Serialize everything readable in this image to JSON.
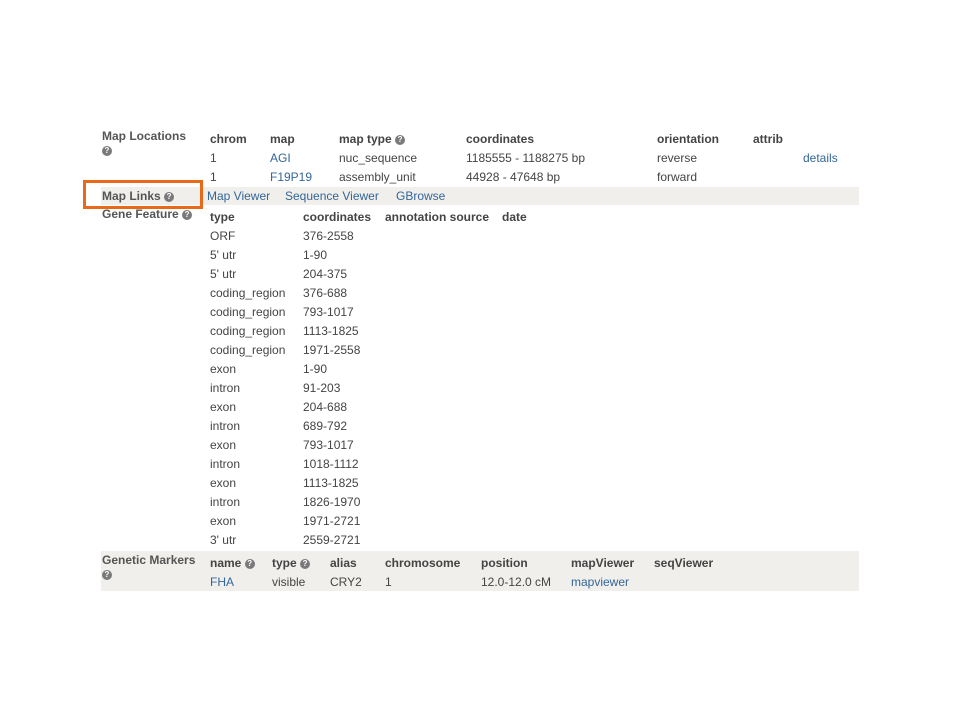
{
  "help_glyph": "?",
  "map_locations": {
    "title": "Map Locations",
    "headers": [
      "chrom",
      "map",
      "map type",
      "coordinates",
      "orientation",
      "attrib"
    ],
    "rows": [
      {
        "chrom": "1",
        "map": "AGI",
        "map_type": "nuc_sequence",
        "coordinates": "1185555 - 1188275 bp",
        "orientation": "reverse",
        "attrib": "details"
      },
      {
        "chrom": "1",
        "map": "F19P19",
        "map_type": "assembly_unit",
        "coordinates": "44928 - 47648 bp",
        "orientation": "forward",
        "attrib": ""
      }
    ]
  },
  "map_links": {
    "title": "Map Links",
    "links": [
      "Map Viewer",
      "Sequence Viewer",
      "GBrowse"
    ]
  },
  "gene_feature": {
    "title": "Gene Feature",
    "headers": [
      "type",
      "coordinates",
      "annotation source",
      "date"
    ],
    "rows": [
      {
        "type": "ORF",
        "coordinates": "376-2558"
      },
      {
        "type": "5' utr",
        "coordinates": "1-90"
      },
      {
        "type": "5' utr",
        "coordinates": "204-375"
      },
      {
        "type": "coding_region",
        "coordinates": "376-688"
      },
      {
        "type": "coding_region",
        "coordinates": "793-1017"
      },
      {
        "type": "coding_region",
        "coordinates": "1113-1825"
      },
      {
        "type": "coding_region",
        "coordinates": "1971-2558"
      },
      {
        "type": "exon",
        "coordinates": "1-90"
      },
      {
        "type": "intron",
        "coordinates": "91-203"
      },
      {
        "type": "exon",
        "coordinates": "204-688"
      },
      {
        "type": "intron",
        "coordinates": "689-792"
      },
      {
        "type": "exon",
        "coordinates": "793-1017"
      },
      {
        "type": "intron",
        "coordinates": "1018-1112"
      },
      {
        "type": "exon",
        "coordinates": "1113-1825"
      },
      {
        "type": "intron",
        "coordinates": "1826-1970"
      },
      {
        "type": "exon",
        "coordinates": "1971-2721"
      },
      {
        "type": "3' utr",
        "coordinates": "2559-2721"
      }
    ]
  },
  "genetic_markers": {
    "title": "Genetic Markers",
    "headers": [
      "name",
      "type",
      "alias",
      "chromosome",
      "position",
      "mapViewer",
      "seqViewer"
    ],
    "row": {
      "name": "FHA",
      "type": "visible",
      "alias": "CRY2",
      "chromosome": "1",
      "position": "12.0-12.0 cM",
      "mapviewer": "mapviewer"
    }
  },
  "colors": {
    "link": "#336699",
    "shaded_row": "#f1efeb",
    "highlight": "#e8691a"
  }
}
